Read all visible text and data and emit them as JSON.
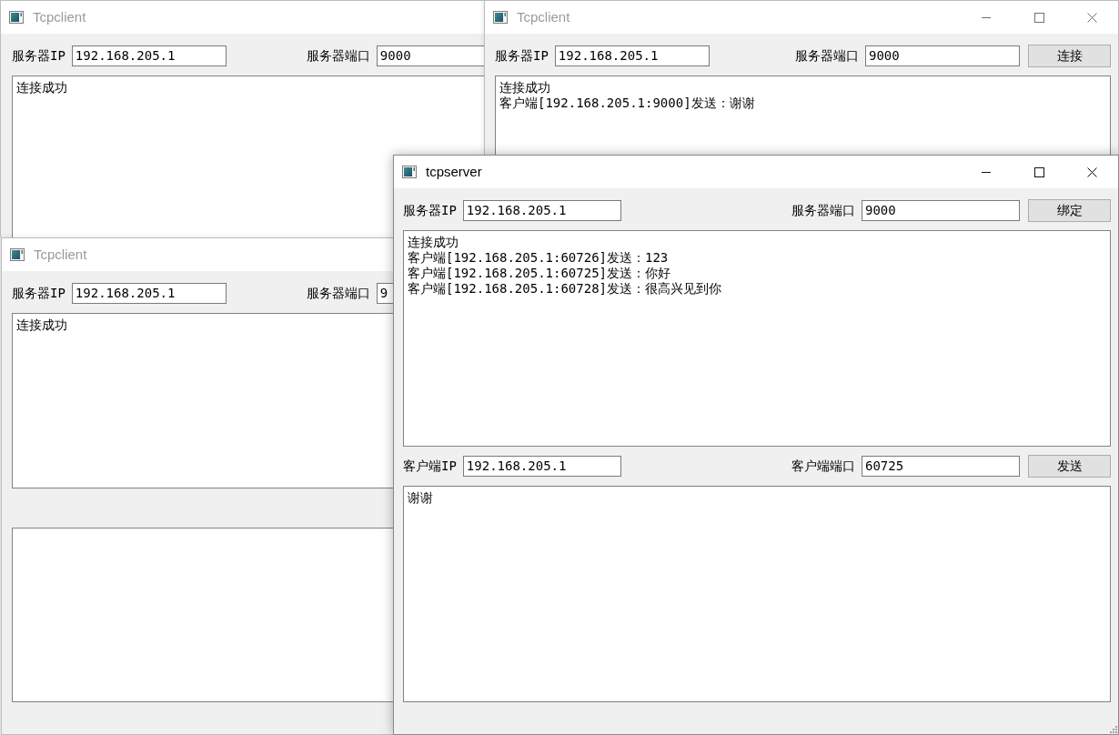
{
  "windows": [
    {
      "title": "Tcpclient",
      "active": false,
      "sections": [
        {
          "kind": "fields",
          "items": [
            {
              "label": "服务器IP",
              "value": "192.168.205.1"
            },
            {
              "label": "服务器端口",
              "value": "9000"
            }
          ]
        },
        {
          "kind": "log",
          "lines": [
            "连接成功"
          ]
        }
      ]
    },
    {
      "title": "Tcpclient",
      "active": false,
      "sections": [
        {
          "kind": "fields",
          "items": [
            {
              "label": "服务器IP",
              "value": "192.168.205.1"
            },
            {
              "label": "服务器端口",
              "value": "9000"
            }
          ],
          "button": "连接"
        },
        {
          "kind": "log",
          "lines": [
            "连接成功",
            "客户端[192.168.205.1:9000]发送：谢谢"
          ]
        }
      ]
    },
    {
      "title": "Tcpclient",
      "active": false,
      "sections": [
        {
          "kind": "fields",
          "items": [
            {
              "label": "服务器IP",
              "value": "192.168.205.1"
            },
            {
              "label": "服务器端口",
              "value": "9"
            }
          ]
        },
        {
          "kind": "log",
          "lines": [
            "连接成功"
          ]
        },
        {
          "kind": "input"
        }
      ]
    },
    {
      "title": "tcpserver",
      "active": true,
      "sections": [
        {
          "kind": "fields",
          "items": [
            {
              "label": "服务器IP",
              "value": "192.168.205.1"
            },
            {
              "label": "服务器端口",
              "value": "9000"
            }
          ],
          "button": "绑定"
        },
        {
          "kind": "log",
          "lines": [
            "连接成功",
            "客户端[192.168.205.1:60726]发送：123",
            "客户端[192.168.205.1:60725]发送：你好",
            "客户端[192.168.205.1:60728]发送：很高兴见到你"
          ]
        },
        {
          "kind": "fields",
          "items": [
            {
              "label": "客户端IP",
              "value": "192.168.205.1"
            },
            {
              "label": "客户端端口",
              "value": "60725"
            }
          ],
          "button": "发送"
        },
        {
          "kind": "input",
          "value": "谢谢"
        }
      ]
    }
  ]
}
